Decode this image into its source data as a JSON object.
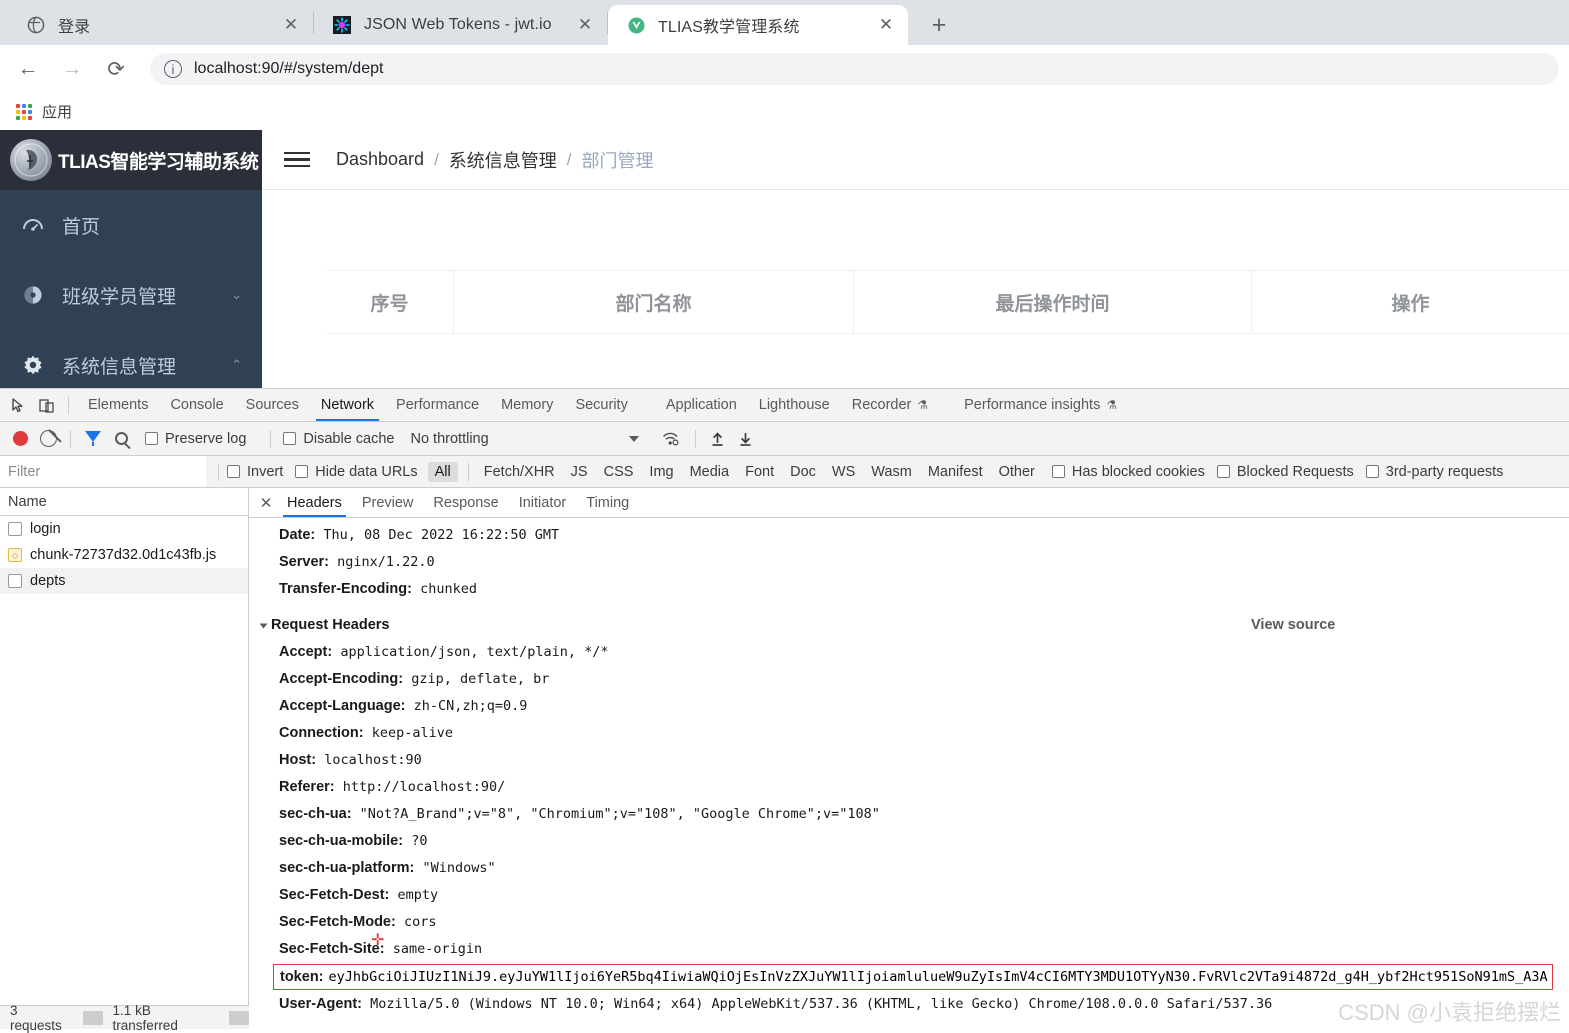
{
  "browser": {
    "tabs": [
      {
        "title": "登录",
        "favicon": "globe-icon",
        "active": false
      },
      {
        "title": "JSON Web Tokens - jwt.io",
        "favicon": "jwt-icon",
        "active": false
      },
      {
        "title": "TLIAS教学管理系统",
        "favicon": "vue-icon",
        "active": true
      }
    ],
    "new_tab_label": "+",
    "close_label": "✕",
    "nav": {
      "back": "←",
      "forward": "→",
      "reload": "⟳"
    },
    "omnibox": {
      "value": "localhost:90/#/system/dept",
      "info_icon": "ⓘ"
    },
    "bookmarks": {
      "apps_label": "应用"
    }
  },
  "app": {
    "logo_text": "TLIAS智能学习辅助系统",
    "menu": [
      {
        "label": "首页",
        "icon": "dashboard-icon",
        "arrow": ""
      },
      {
        "label": "班级学员管理",
        "icon": "class-icon",
        "arrow": "⌄"
      },
      {
        "label": "系统信息管理",
        "icon": "gear-icon",
        "arrow": "⌃"
      }
    ],
    "breadcrumb": [
      {
        "label": "Dashboard",
        "muted": false
      },
      {
        "label": "系统信息管理",
        "muted": false
      },
      {
        "label": "部门管理",
        "muted": true
      }
    ],
    "crumb_sep": "/",
    "table_headers": [
      "序号",
      "部门名称",
      "最后操作时间",
      "操作"
    ]
  },
  "devtools": {
    "panel_tabs": [
      {
        "label": "Elements",
        "selected": false
      },
      {
        "label": "Console",
        "selected": false
      },
      {
        "label": "Sources",
        "selected": false
      },
      {
        "label": "Network",
        "selected": true
      },
      {
        "label": "Performance",
        "selected": false
      },
      {
        "label": "Memory",
        "selected": false
      },
      {
        "label": "Security",
        "selected": false
      },
      {
        "label": "Application",
        "selected": false
      },
      {
        "label": "Lighthouse",
        "selected": false
      },
      {
        "label": "Recorder",
        "selected": false,
        "flask": true
      },
      {
        "label": "Performance insights",
        "selected": false,
        "flask": true
      }
    ],
    "controls": {
      "preserve_log": "Preserve log",
      "disable_cache": "Disable cache",
      "throttling": "No throttling"
    },
    "filterbar": {
      "filter_placeholder": "Filter",
      "invert": "Invert",
      "hide_data_urls": "Hide data URLs",
      "types": [
        "All",
        "Fetch/XHR",
        "JS",
        "CSS",
        "Img",
        "Media",
        "Font",
        "Doc",
        "WS",
        "Wasm",
        "Manifest",
        "Other"
      ],
      "selected_type": "All",
      "has_blocked_cookies": "Has blocked cookies",
      "blocked_requests": "Blocked Requests",
      "third_party": "3rd-party requests"
    },
    "requests_header": "Name",
    "requests": [
      {
        "name": "login",
        "icon": "doc-icon"
      },
      {
        "name": "chunk-72737d32.0d1c43fb.js",
        "icon": "js-icon"
      },
      {
        "name": "depts",
        "icon": "doc-icon",
        "selected": true
      }
    ],
    "status": {
      "requests": "3 requests",
      "transferred": "1.1 kB transferred"
    },
    "sub_tabs": [
      {
        "label": "Headers",
        "selected": true
      },
      {
        "label": "Preview",
        "selected": false
      },
      {
        "label": "Response",
        "selected": false
      },
      {
        "label": "Initiator",
        "selected": false
      },
      {
        "label": "Timing",
        "selected": false
      }
    ],
    "response_headers": [
      {
        "name": "Date:",
        "value": "Thu, 08 Dec 2022 16:22:50 GMT"
      },
      {
        "name": "Server:",
        "value": "nginx/1.22.0"
      },
      {
        "name": "Transfer-Encoding:",
        "value": "chunked"
      }
    ],
    "request_headers_title": "Request Headers",
    "view_source": "View source",
    "request_headers": [
      {
        "name": "Accept:",
        "value": "application/json, text/plain, */*"
      },
      {
        "name": "Accept-Encoding:",
        "value": "gzip, deflate, br"
      },
      {
        "name": "Accept-Language:",
        "value": "zh-CN,zh;q=0.9"
      },
      {
        "name": "Connection:",
        "value": "keep-alive"
      },
      {
        "name": "Host:",
        "value": "localhost:90"
      },
      {
        "name": "Referer:",
        "value": "http://localhost:90/"
      },
      {
        "name": "sec-ch-ua:",
        "value": "\"Not?A_Brand\";v=\"8\", \"Chromium\";v=\"108\", \"Google Chrome\";v=\"108\""
      },
      {
        "name": "sec-ch-ua-mobile:",
        "value": "?0"
      },
      {
        "name": "sec-ch-ua-platform:",
        "value": "\"Windows\""
      },
      {
        "name": "Sec-Fetch-Dest:",
        "value": "empty"
      },
      {
        "name": "Sec-Fetch-Mode:",
        "value": "cors"
      },
      {
        "name": "Sec-Fetch-Site:",
        "value": "same-origin"
      }
    ],
    "token_header": {
      "name": "token:",
      "value": "eyJhbGciOiJIUzI1NiJ9.eyJuYW1lIjoi6YeR5bq4IiwiaWQiOjEsInVzZXJuYW1lIjoiamlulueW9uZyIsImV4cCI6MTY3MDU1OTYyN30.FvRVlc2VTa9i4872d_g4H_ybf2Hct951SoN91mS_A3A",
      "highlight_color": "#e03a3a"
    },
    "user_agent": {
      "name": "User-Agent:",
      "value": "Mozilla/5.0 (Windows NT 10.0; Win64; x64) AppleWebKit/537.36 (KHTML, like Gecko) Chrome/108.0.0.0 Safari/537.36"
    }
  },
  "watermark": "CSDN @小袁拒绝摆烂"
}
